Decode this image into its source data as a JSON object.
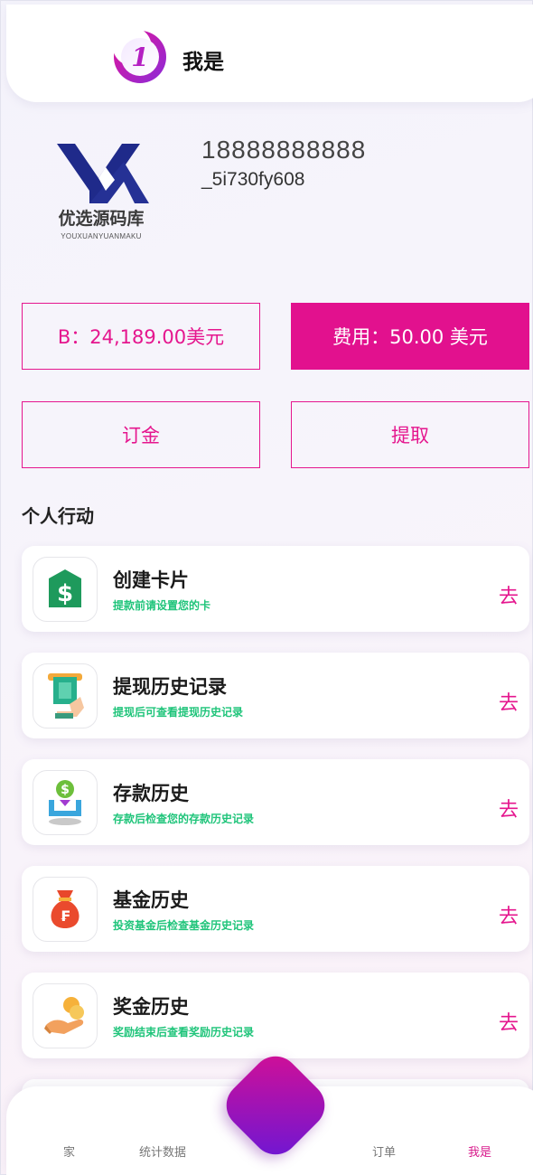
{
  "header": {
    "title": "我是"
  },
  "profile": {
    "brand_cn": "优选源码库",
    "brand_en": "YOUXUANYUANMAKU",
    "phone": "18888888888",
    "user_id": "_5i730fy608"
  },
  "balance": {
    "balance_label": "B：24,189.00美元",
    "fee_label": "费用：50.00 美元",
    "deposit_label": "订金",
    "withdraw_label": "提取"
  },
  "section_title": "个人行动",
  "actions": [
    {
      "title": "创建卡片",
      "subtitle": "提款前请设置您的卡",
      "go": "去",
      "icon": "card-dollar-icon"
    },
    {
      "title": "提现历史记录",
      "subtitle": "提现后可查看提现历史记录",
      "go": "去",
      "icon": "atm-withdraw-icon"
    },
    {
      "title": "存款历史",
      "subtitle": "存款后检查您的存款历史记录",
      "go": "去",
      "icon": "deposit-coin-icon"
    },
    {
      "title": "基金历史",
      "subtitle": "投资基金后检查基金历史记录",
      "go": "去",
      "icon": "money-bag-icon"
    },
    {
      "title": "奖金历史",
      "subtitle": "奖励结束后查看奖励历史记录",
      "go": "去",
      "icon": "hand-coins-icon"
    }
  ],
  "nav": {
    "home": "家",
    "stats": "统计数据",
    "orders": "订单",
    "me": "我是"
  },
  "colors": {
    "accent": "#e2118e",
    "success_text": "#1fc47a",
    "fab_gradient_start": "#d60f93",
    "fab_gradient_end": "#6a17d6"
  }
}
